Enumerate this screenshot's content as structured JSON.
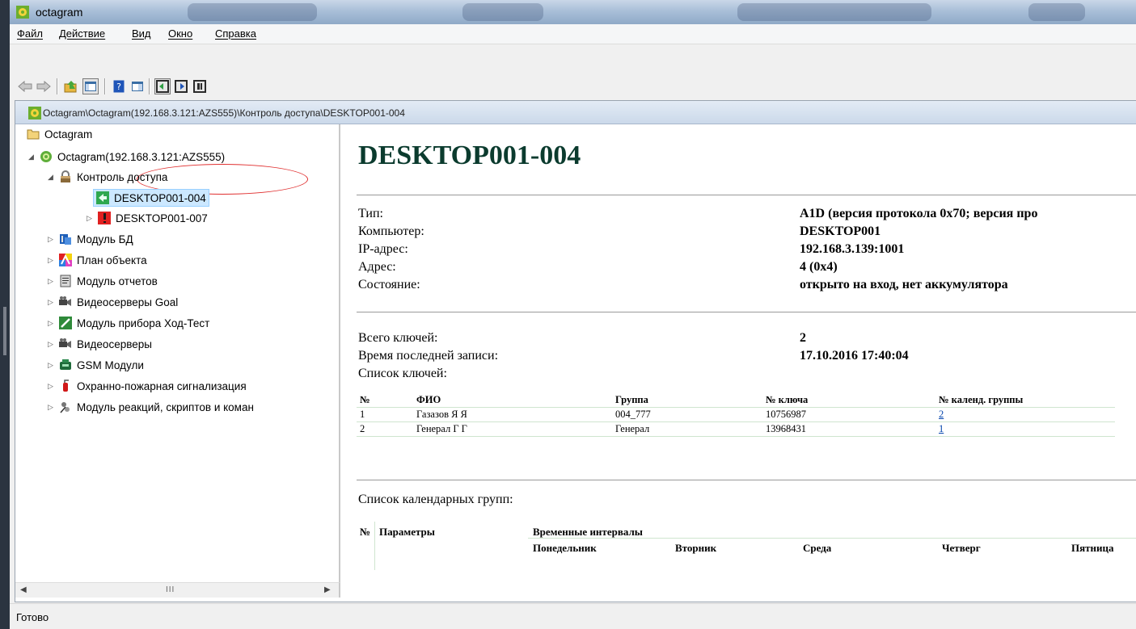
{
  "window": {
    "title": "octagram"
  },
  "menu": [
    "Файл",
    "Действие",
    "Вид",
    "Окно",
    "Справка"
  ],
  "inner_window": {
    "path": "Octagram\\Octagram(192.168.3.121:AZS555)\\Контроль доступа\\DESKTOP001-004"
  },
  "tree": {
    "root": "Octagram",
    "server": "Octagram(192.168.3.121:AZS555)",
    "access_control": "Контроль доступа",
    "device_selected": "DESKTOP001-004",
    "device_other": "DESKTOP001-007",
    "modules": [
      "Модуль БД",
      "План объекта",
      "Модуль отчетов",
      "Видеосерверы Goal",
      "Модуль прибора Ход-Тест",
      "Видеосерверы",
      "GSM Модули",
      "Охранно-пожарная сигнализация",
      "Модуль реакций, скриптов и коман"
    ],
    "scroll_grip": "III"
  },
  "detail": {
    "heading": "DESKTOP001-004",
    "info": [
      {
        "label": "Тип:",
        "value": "A1D (версия протокола 0x70; версия про"
      },
      {
        "label": "Компьютер:",
        "value": "DESKTOP001"
      },
      {
        "label": "IP-адрес:",
        "value": "192.168.3.139:1001"
      },
      {
        "label": "Адрес:",
        "value": "4 (0x4)"
      },
      {
        "label": "Состояние:",
        "value": "открыто на вход, нет аккумулятора"
      }
    ],
    "total_keys_label": "Всего ключей:",
    "total_keys_value": "2",
    "last_record_label": "Время последней записи:",
    "last_record_value": "17.10.2016 17:40:04",
    "key_list_label": "Список ключей:",
    "keys_table": {
      "headers": [
        "№",
        "ФИО",
        "Группа",
        "№ ключа",
        "№ календ. группы"
      ],
      "rows": [
        [
          "1",
          "Газазов Я Я",
          "004_777",
          "10756987",
          "2"
        ],
        [
          "2",
          "Генерал Г Г",
          "Генерал",
          "13968431",
          "1"
        ]
      ]
    },
    "calendar_list_label": "Список календарных групп:",
    "calendar_table": {
      "headers": [
        "№",
        "Параметры",
        "Временные интервалы"
      ],
      "days": [
        "Понедельник",
        "Вторник",
        "Среда",
        "Четверг",
        "Пятница"
      ]
    }
  },
  "status": "Готово"
}
